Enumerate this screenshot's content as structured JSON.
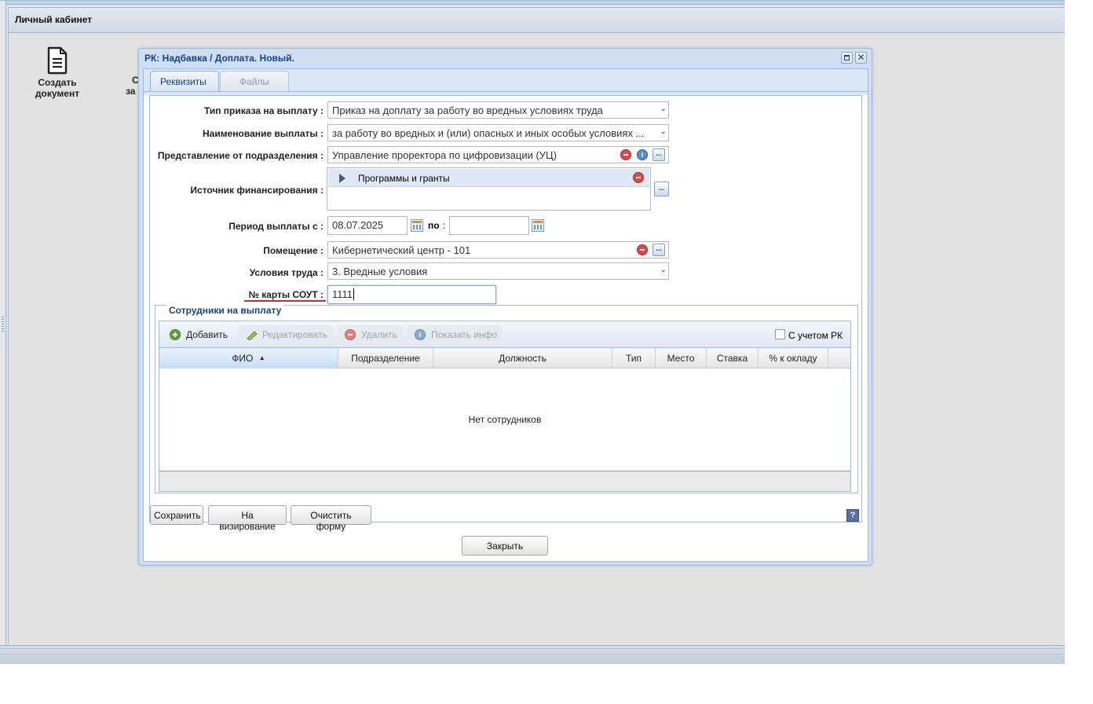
{
  "app": {
    "panel_title": "Личный кабинет",
    "desktop_icons": [
      {
        "label_line1": "Создать",
        "label_line2": "документ"
      },
      {
        "label_line1": "С",
        "label_line2": "за"
      }
    ]
  },
  "window": {
    "title": "РК: Надбавка / Доплата. Новый.",
    "tabs": [
      {
        "label": "Реквизиты",
        "active": true
      },
      {
        "label": "Файлы",
        "active": false
      }
    ],
    "form": {
      "order_type": {
        "label": "Тип приказа на выплату :",
        "value": "Приказ на доплату за работу во вредных условиях труда"
      },
      "payment_name": {
        "label": "Наименование выплаты :",
        "value": "за работу во вредных и (или) опасных и иных особых условиях ..."
      },
      "department": {
        "label": "Представление от подразделения :",
        "value": "Управление проректора по цифровизации (УЦ)"
      },
      "funding": {
        "label": "Источник финансирования :",
        "items": [
          "Программы и гранты"
        ]
      },
      "period": {
        "label": "Период выплаты с :",
        "from": "08.07.2025",
        "to_label": "по",
        "to_sep": ":",
        "to": ""
      },
      "room": {
        "label": "Помещение :",
        "value": "Кибернетический центр - 101"
      },
      "conditions": {
        "label": "Условия труда :",
        "value": "3. Вредные условия"
      },
      "sout_card": {
        "label": "№ карты СОУТ :",
        "value": "1111"
      }
    },
    "employees": {
      "legend": "Сотрудники на выплату",
      "toolbar": {
        "add": "Добавить",
        "edit": "Редактировать",
        "delete": "Удалить",
        "info": "Показать инфо",
        "rk_checkbox": "С учетом РК"
      },
      "columns": [
        "ФИО",
        "Подразделение",
        "Должность",
        "Тип",
        "Место",
        "Ставка",
        "% к окладу"
      ],
      "sorted_column": "ФИО",
      "empty_text": "Нет сотрудников"
    },
    "buttons": {
      "save": "Сохранить",
      "send_for_approval": "На визирование",
      "clear": "Очистить форму",
      "close": "Закрыть",
      "help": "?"
    }
  },
  "colors": {
    "title_blue": "#15428b",
    "window_border": "#99bbe8",
    "sout_underline": "#c0302c",
    "delete_red": "#e0494a"
  }
}
